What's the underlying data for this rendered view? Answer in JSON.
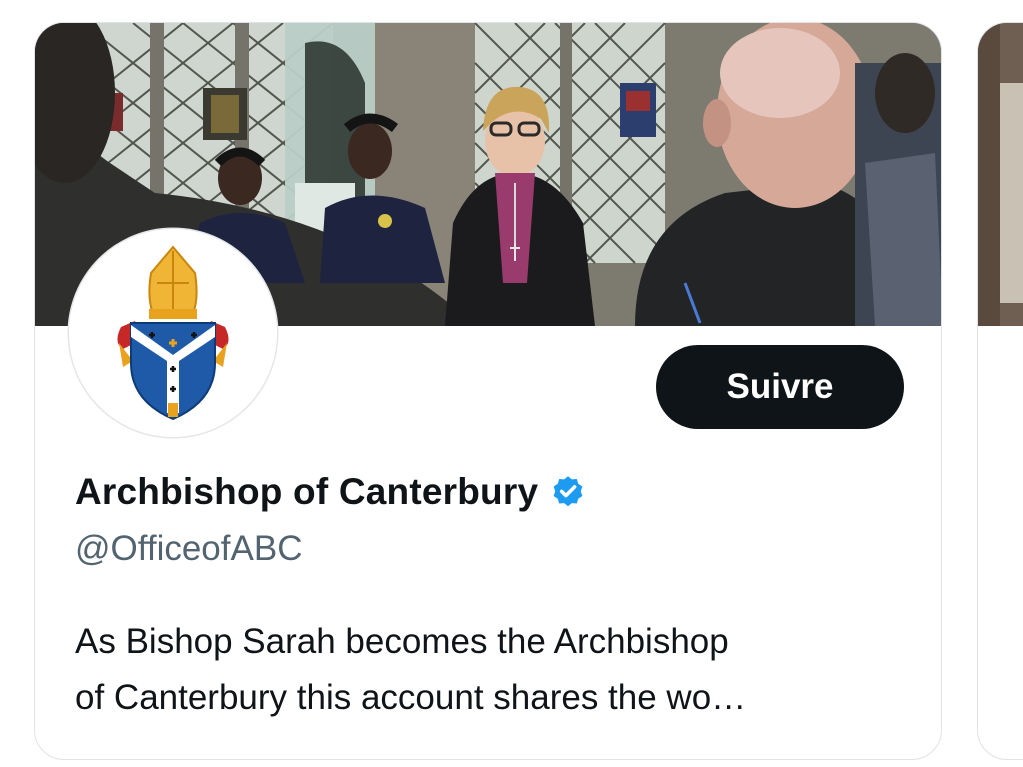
{
  "profile_card": {
    "display_name": "Archbishop of Canterbury",
    "verified": true,
    "verified_icon": "verified-badge-icon",
    "verified_color": "#1d9bf0",
    "handle": "@OfficeofABC",
    "follow_label": "Suivre",
    "bio_lines": [
      "As Bishop Sarah becomes the Archbishop",
      "of Canterbury this account shares the wo…"
    ],
    "avatar_icon": "diocesan-coat-of-arms-icon",
    "banner_image": "photo-bishop-with-students"
  },
  "colors": {
    "follow_button_bg": "#0f1419",
    "follow_button_text": "#ffffff",
    "handle_text": "#536471",
    "primary_text": "#0f1419",
    "card_border": "#dfe3e8"
  }
}
